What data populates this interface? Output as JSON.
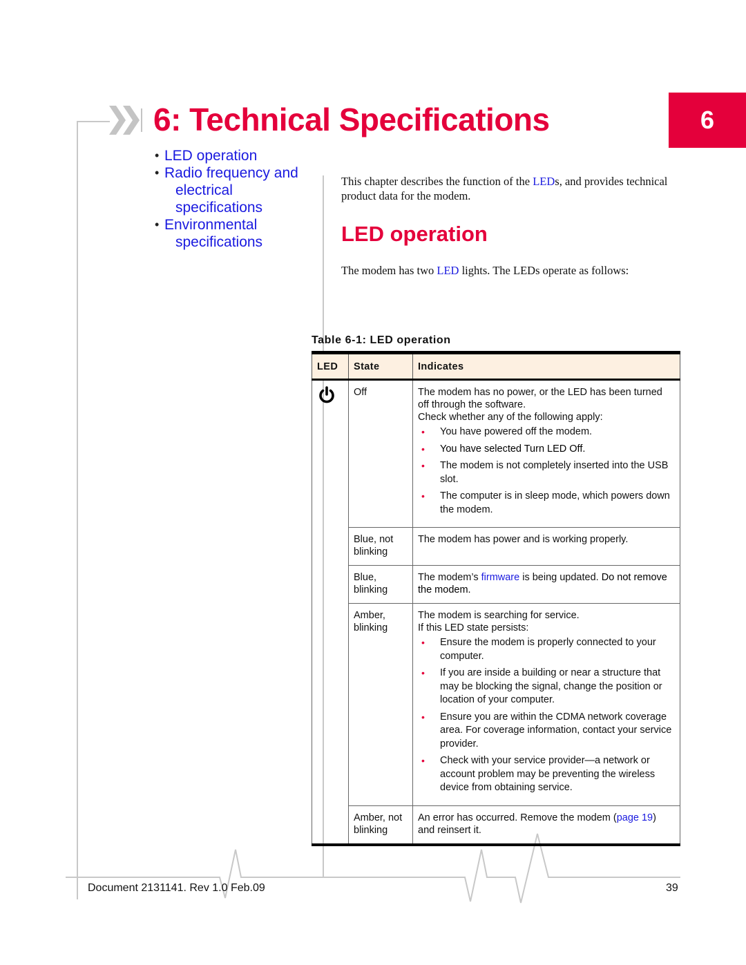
{
  "chapter": {
    "title": "6: Technical Specifications",
    "tab_number": "6"
  },
  "toc": [
    {
      "lines": [
        "LED operation"
      ]
    },
    {
      "lines": [
        "Radio frequency and",
        "electrical",
        "specifications"
      ]
    },
    {
      "lines": [
        "Environmental",
        "specifications"
      ]
    }
  ],
  "intro": {
    "before": "This chapter describes the function of the ",
    "link": "LED",
    "after": "s, and provides technical product data for the modem."
  },
  "section": {
    "heading": "LED operation",
    "para_before": "The modem has two ",
    "para_link": "LED",
    "para_after": " lights. The LEDs operate as follows:"
  },
  "table": {
    "caption": "Table 6-1: LED operation",
    "headers": [
      "LED",
      "State",
      "Indicates"
    ],
    "led_icon": "power-icon",
    "rows": [
      {
        "state": "Off",
        "lines": [
          "The modem has no power, or the LED has been turned off through the software.",
          "Check whether any of the following apply:"
        ],
        "bullets": [
          "You have powered off the modem.",
          "You have selected Turn LED Off.",
          "The modem is not completely inserted into the USB slot.",
          "The computer is in sleep mode, which powers down the modem."
        ]
      },
      {
        "state": "Blue, not blinking",
        "lines": [
          "The modem has power and is working properly."
        ]
      },
      {
        "state": "Blue, blinking",
        "text_before": "The modem’s ",
        "link": "firmware",
        "text_after": " is being updated. ",
        "emphasis": "Do not remove the modem."
      },
      {
        "state": "Amber, blinking",
        "lines": [
          "The modem is searching for service.",
          "If this LED state persists:"
        ],
        "bullets": [
          "Ensure the modem is properly connected to your computer.",
          "If you are inside a building or near a structure that may be blocking the signal, change the position or location of your computer.",
          "Ensure you are within the CDMA network coverage area. For coverage information, contact your service provider.",
          "Check with your service provider—a network or account problem may be preventing the wireless device from obtaining service."
        ]
      },
      {
        "state": "Amber, not blinking",
        "text_before": "An error has occurred. Remove the modem (",
        "link": "page 19",
        "text_after": ") and reinsert it."
      }
    ]
  },
  "footer": {
    "document": "Document 2131141. Rev 1.0  Feb.09",
    "page": "39"
  },
  "colors": {
    "brand_red": "#e4003b",
    "link_blue": "#1a1adf",
    "header_bg": "#fdf0e1",
    "rule_gray": "#c8c8c8"
  }
}
